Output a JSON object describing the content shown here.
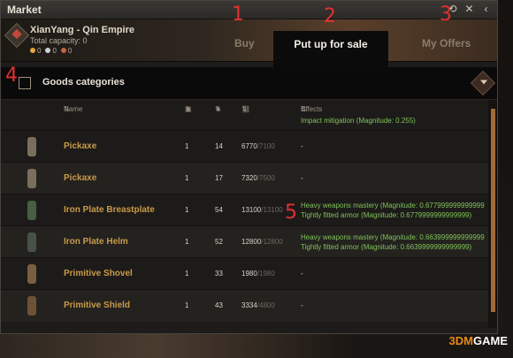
{
  "window": {
    "title": "Market"
  },
  "header": {
    "location": "XianYang - Qin Empire",
    "capacity": "Total capacity: 0",
    "coins": [
      {
        "value": "0",
        "color": "#e3a83a"
      },
      {
        "value": "0",
        "color": "#cfd2d6"
      },
      {
        "value": "0",
        "color": "#c5643b"
      }
    ]
  },
  "tabs": {
    "buy": "Buy",
    "sale": "Put up for sale",
    "offers": "My Offers"
  },
  "categories": {
    "label": "Goods categories"
  },
  "table": {
    "headers": {
      "name": "Name",
      "effects": "Effects"
    },
    "partial_effect": "Impact mitigation (Magnitude: 0.255)",
    "rows": [
      {
        "name": "Pickaxe",
        "c1": "1",
        "c2": "14",
        "cur": "6770",
        "max": "/7100",
        "effects": [
          "-"
        ],
        "color": "#8a7c6a"
      },
      {
        "name": "Pickaxe",
        "c1": "1",
        "c2": "17",
        "cur": "7320",
        "max": "/7500",
        "effects": [
          "-"
        ],
        "color": "#8a7c6a"
      },
      {
        "name": "Iron Plate Breastplate",
        "c1": "1",
        "c2": "54",
        "cur": "13100",
        "max": "/13100",
        "effects": [
          "Heavy weapons mastery (Magnitude: 0.677999999999999",
          "Tightly fitted armor (Magnitude: 0.6779999999999999)"
        ],
        "color": "#4f6a4a"
      },
      {
        "name": "Iron Plate Helm",
        "c1": "1",
        "c2": "52",
        "cur": "12800",
        "max": "/12800",
        "effects": [
          "Heavy weapons mastery (Magnitude: 0.663999999999999",
          "Tightly fitted armor (Magnitude: 0.6639999999999999)"
        ],
        "color": "#4e5a4f"
      },
      {
        "name": "Primitive Shovel",
        "c1": "1",
        "c2": "33",
        "cur": "1980",
        "max": "/1980",
        "effects": [
          "-"
        ],
        "color": "#8a6a4a"
      },
      {
        "name": "Primitive Shield",
        "c1": "1",
        "c2": "43",
        "cur": "3334",
        "max": "/4800",
        "effects": [
          "-"
        ],
        "color": "#7a5a3a"
      }
    ]
  },
  "annotations": [
    "1",
    "2",
    "3",
    "4",
    "5"
  ],
  "watermark": {
    "prefix": "3DM",
    "suffix": "GAME"
  }
}
